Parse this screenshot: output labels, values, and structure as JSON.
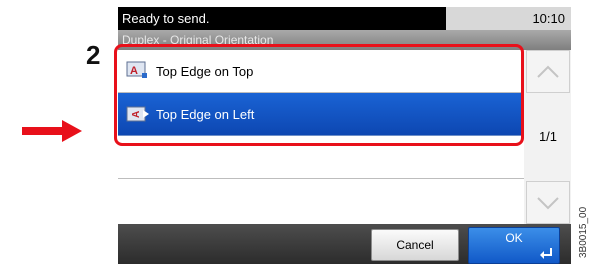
{
  "step_number": "2",
  "status": {
    "message": "Ready to send.",
    "time": "10:10"
  },
  "title": "Duplex - Original Orientation",
  "options": [
    {
      "label": "Top Edge on Top",
      "selected": false
    },
    {
      "label": "Top Edge on Left",
      "selected": true
    }
  ],
  "page_indicator": "1/1",
  "buttons": {
    "cancel": "Cancel",
    "ok": "OK"
  },
  "figure_code": "3B0015_00",
  "colors": {
    "selected_row": "#0d47b2",
    "highlight_border": "#e8101a",
    "arrow": "#e8101a"
  }
}
